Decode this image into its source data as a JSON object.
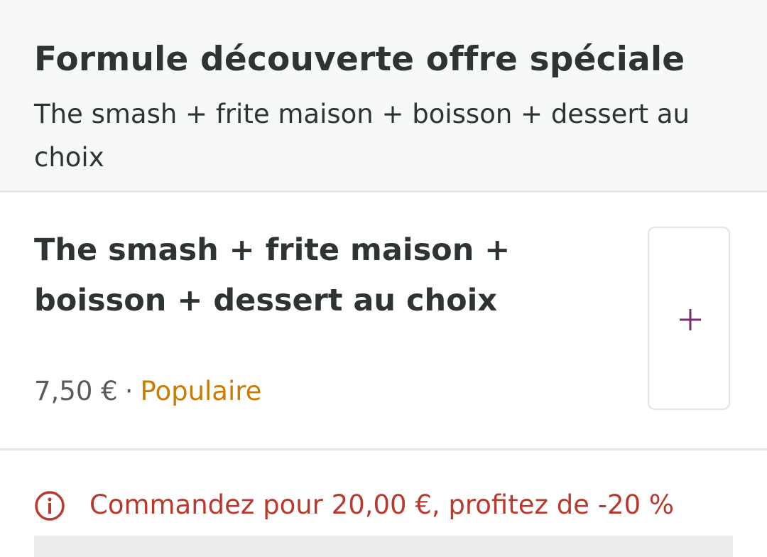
{
  "category": {
    "title": "Formule découverte offre spéciale",
    "description": "The smash + frite maison + boisson + dessert au choix"
  },
  "item": {
    "name": "The smash + frite maison + boisson + dessert au choix",
    "price": "7,50 €",
    "separator": "·",
    "tag": "Populaire",
    "add_icon": "plus-icon"
  },
  "promo": {
    "icon": "info-icon",
    "text": "Commandez pour 20,00 €, profitez de -20 %"
  },
  "colors": {
    "accent_add": "#7a2b72",
    "popular": "#cc7a00",
    "promo": "#b83a2e"
  }
}
